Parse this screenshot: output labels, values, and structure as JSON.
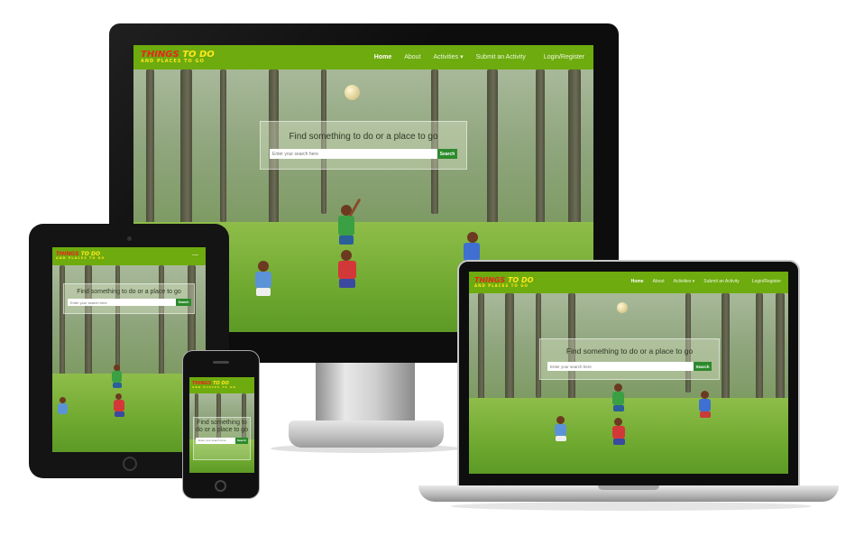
{
  "logo": {
    "main_a": "THINGS",
    "main_b": "TO DO",
    "sub": "AND PLACES TO GO"
  },
  "nav": {
    "home": "Home",
    "about": "About",
    "activities": "Activities",
    "submit": "Submit an Activity",
    "login": "Login/Register",
    "hamburger": "—"
  },
  "hero": {
    "title": "Find something to do or a place to go",
    "search_placeholder": "Enter your search here",
    "search_button": "Search"
  },
  "colors": {
    "navbar": "#6dab0e",
    "search_button": "#2c8a2c",
    "logo_red": "#e8261b",
    "logo_yellow": "#ffe81a"
  }
}
